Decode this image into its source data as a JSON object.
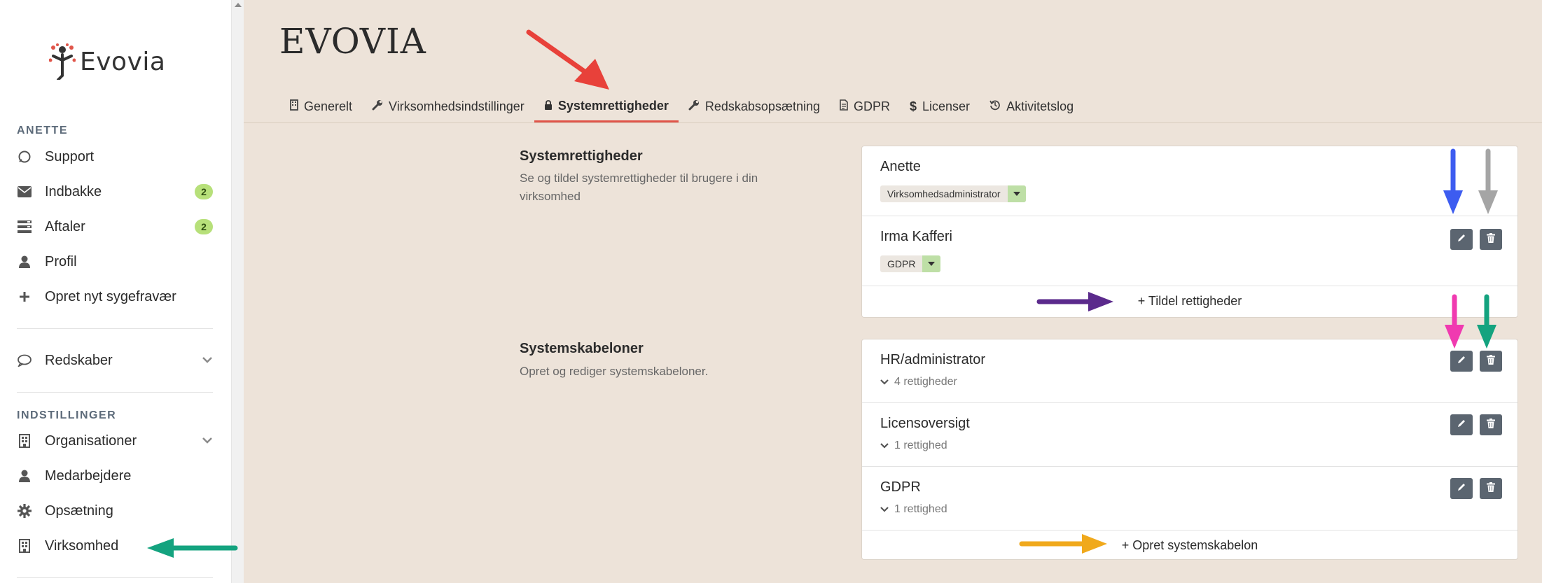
{
  "logo": {
    "text": "Evovia"
  },
  "sidebar": {
    "user_section": "ANETTE",
    "items": [
      {
        "label": "Support",
        "icon": "support-icon"
      },
      {
        "label": "Indbakke",
        "icon": "envelope-icon",
        "badge": "2"
      },
      {
        "label": "Aftaler",
        "icon": "list-icon",
        "badge": "2"
      },
      {
        "label": "Profil",
        "icon": "user-icon"
      },
      {
        "label": "Opret nyt sygefravær",
        "icon": "plus-icon"
      }
    ],
    "tools": {
      "label": "Redskaber",
      "icon": "chat-icon"
    },
    "settings_section": "INDSTILLINGER",
    "settings": [
      {
        "label": "Organisationer",
        "icon": "building-icon"
      },
      {
        "label": "Medarbejdere",
        "icon": "user-icon"
      },
      {
        "label": "Opsætning",
        "icon": "gear-icon"
      },
      {
        "label": "Virksomhed",
        "icon": "building-icon"
      }
    ]
  },
  "header": {
    "brand": "EVOVIA"
  },
  "tabs": [
    {
      "label": "Generelt",
      "icon": "building-icon"
    },
    {
      "label": "Virksomhedsindstillinger",
      "icon": "wrench-icon"
    },
    {
      "label": "Systemrettigheder",
      "icon": "lock-icon",
      "active": true
    },
    {
      "label": "Redskabsopsætning",
      "icon": "wrench-icon"
    },
    {
      "label": "GDPR",
      "icon": "document-icon"
    },
    {
      "label": "Licenser",
      "icon": "dollar-icon"
    },
    {
      "label": "Aktivitetslog",
      "icon": "history-icon"
    }
  ],
  "system_rights": {
    "title": "Systemrettigheder",
    "description": "Se og tildel systemrettigheder til brugere i din virksomhed",
    "users": [
      {
        "name": "Anette",
        "role": "Virksomhedsadministrator"
      },
      {
        "name": "Irma Kafferi",
        "role": "GDPR"
      }
    ],
    "assign_link": "+ Tildel rettigheder"
  },
  "system_templates": {
    "title": "Systemskabeloner",
    "description": "Opret og rediger systemskabeloner.",
    "templates": [
      {
        "name": "HR/administrator",
        "count": "4 rettigheder"
      },
      {
        "name": "Licensoversigt",
        "count": "1 rettighed"
      },
      {
        "name": "GDPR",
        "count": "1 rettighed"
      }
    ],
    "create_link": "+ Opret systemskabelon"
  },
  "colors": {
    "background": "#ede3d9",
    "active_tab_underline": "#e0554a",
    "badge": "#b7e07a",
    "action_button": "#5b6570",
    "arrow_red": "#e8413a",
    "arrow_blue": "#3d5cf0",
    "arrow_gray": "#a5a5a5",
    "arrow_purple": "#5b2a8c",
    "arrow_pink": "#f03ab0",
    "arrow_green": "#14a37f",
    "arrow_orange": "#f0a91c"
  }
}
